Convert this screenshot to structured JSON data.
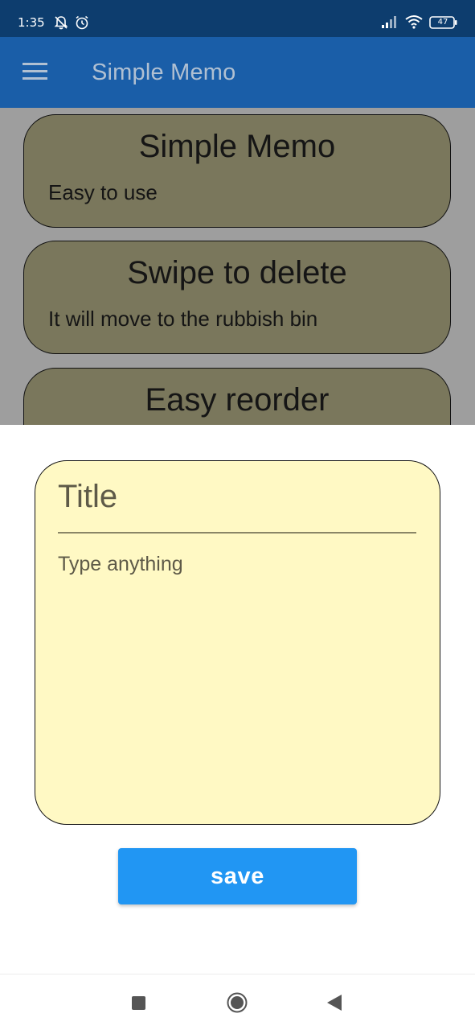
{
  "status_bar": {
    "time": "1:35",
    "battery": "47",
    "icons": [
      "notifications-off-icon",
      "alarm-icon",
      "signal-icon",
      "wifi-icon",
      "battery-icon"
    ]
  },
  "app_bar": {
    "title": "Simple Memo",
    "menu_icon": "hamburger-menu-icon",
    "background": "#1a5ea8"
  },
  "memos": [
    {
      "title": "Simple Memo",
      "body": "Easy to use"
    },
    {
      "title": "Swipe to delete",
      "body": "It will move to the rubbish bin"
    },
    {
      "title": "Easy reorder",
      "body": ""
    }
  ],
  "editor": {
    "title_placeholder": "Title",
    "body_placeholder": "Type anything",
    "title_value": "",
    "body_value": "",
    "card_color": "#fff9c4"
  },
  "save_button": {
    "label": "save",
    "color": "#2196f3"
  },
  "nav_bar": {
    "buttons": [
      "recents-square-icon",
      "home-circle-icon",
      "back-triangle-icon"
    ]
  }
}
